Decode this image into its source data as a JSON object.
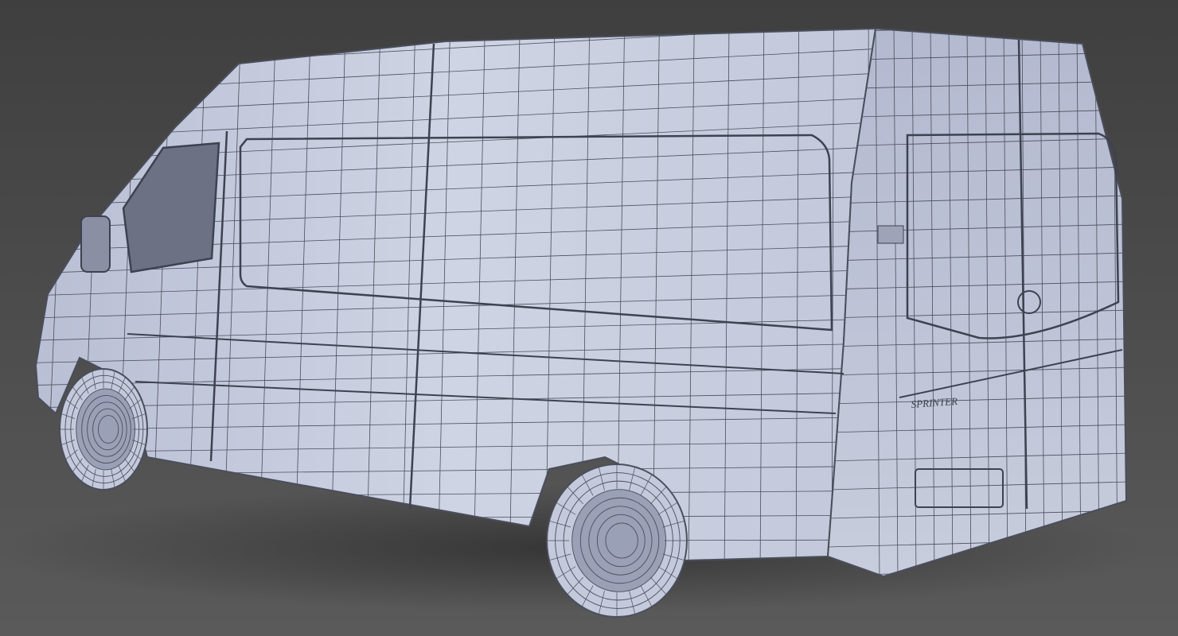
{
  "scene": {
    "subject": "van-wireframe-render",
    "badge_text": "SPRINTER",
    "colors": {
      "background_top": "#3f3f3f",
      "background_bottom": "#585858",
      "body": "#c9cee0",
      "body_shade": "#a9afc6",
      "wire": "#4a4e5c",
      "window": "#6c7184"
    }
  }
}
